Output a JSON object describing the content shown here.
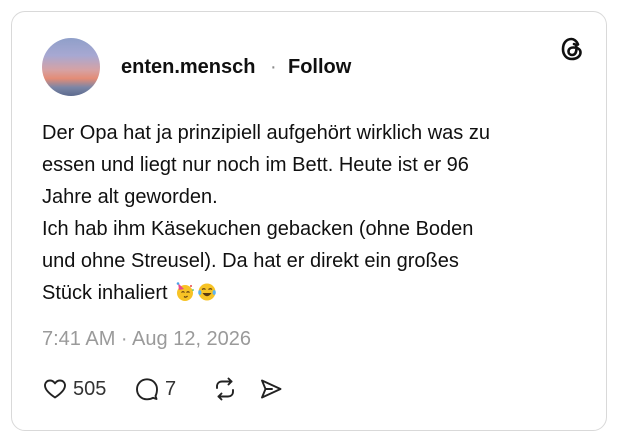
{
  "post": {
    "username": "enten.mensch",
    "separator": "·",
    "follow_label": "Follow",
    "lines": [
      "Der Opa hat ja prinzipiell aufgehört wirklich was zu",
      "essen und liegt nur noch im Bett. Heute ist er 96",
      "Jahre alt geworden.",
      "Ich hab ihm Käsekuchen gebacken (ohne Boden",
      "und ohne Streusel). Da hat er direkt ein großes",
      "Stück inhaliert"
    ],
    "emojis": [
      "partying-face-emoji",
      "face-with-tears-of-joy-emoji"
    ],
    "timestamp": "7:41 AM · Aug 12, 2026",
    "like_count": "505",
    "reply_count": "7"
  },
  "icons": {
    "logo": "threads-logo-icon",
    "like": "heart-icon",
    "reply": "comment-icon",
    "repost": "repost-icon",
    "share": "send-icon"
  }
}
